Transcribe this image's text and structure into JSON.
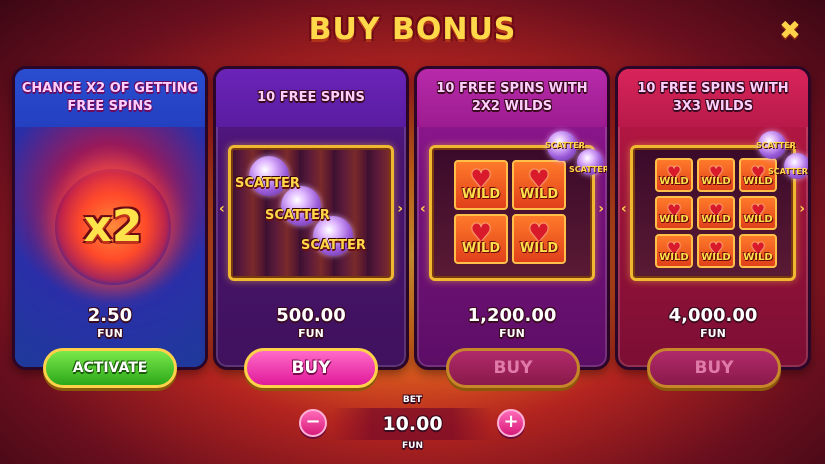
{
  "title": "BUY BONUS",
  "close_icon": "close-icon",
  "cards": [
    {
      "header": "CHANCE X2 OF GETTING FREE SPINS",
      "badge": "x2",
      "price": "2.50",
      "currency": "FUN",
      "button": "ACTIVATE",
      "button_state": "enabled"
    },
    {
      "header": "10 FREE SPINS",
      "symbol_text": "SCATTER",
      "price": "500.00",
      "currency": "FUN",
      "button": "BUY",
      "button_state": "enabled"
    },
    {
      "header": "10 FREE SPINS WITH 2X2 WILDS",
      "symbol_text": "WILD",
      "scatter_text": "SCATTER",
      "price": "1,200.00",
      "currency": "FUN",
      "button": "BUY",
      "button_state": "disabled"
    },
    {
      "header": "10 FREE SPINS WITH 3X3 WILDS",
      "symbol_text": "WILD",
      "scatter_text": "SCATTER",
      "price": "4,000.00",
      "currency": "FUN",
      "button": "BUY",
      "button_state": "disabled"
    }
  ],
  "bet": {
    "label": "BET",
    "value": "10.00",
    "currency": "FUN",
    "minus": "−",
    "plus": "+"
  },
  "colors": {
    "activate": "#2ca81a",
    "buy": "#e01a9a",
    "buy_disabled": "#8a1a4a",
    "title": "#ffd94a"
  }
}
